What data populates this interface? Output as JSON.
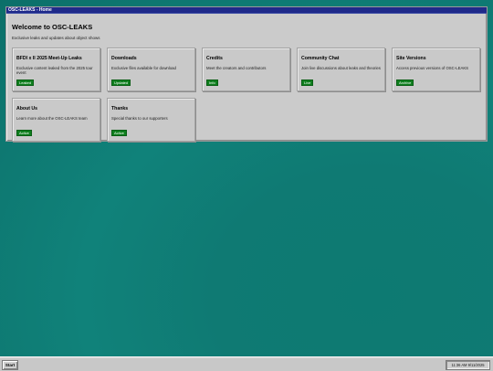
{
  "window": {
    "title": "OSC-LEAKS - Home",
    "heading": "Welcome to OSC-LEAKS",
    "subtitle": "Exclusive leaks and updates about object shows"
  },
  "cards": [
    {
      "title": "BFDI x II 2025 Meet-Up Leaks",
      "description": "Exclusive content leaked from the 2025 tour event",
      "badge": "Leaked"
    },
    {
      "title": "Downloads",
      "description": "Exclusive files available for download",
      "badge": "Updated"
    },
    {
      "title": "Credits",
      "description": "Meet the creators and contributors",
      "badge": "Info"
    },
    {
      "title": "Community Chat",
      "description": "Join live discussions about leaks and theories",
      "badge": "Live"
    },
    {
      "title": "Site Versions",
      "description": "Access previous versions of OSC-LEAKS",
      "badge": "Archive"
    },
    {
      "title": "About Us",
      "description": "Learn more about the OSC-LEAKS team",
      "badge": "Active"
    },
    {
      "title": "Thanks",
      "description": "Special thanks to our supporters",
      "badge": "Active"
    }
  ],
  "taskbar": {
    "start_label": "Start",
    "clock": "11:36 AM 9/11/2025"
  },
  "colors": {
    "desktop": "#0f7a73",
    "titlebar": "#1f2a8a",
    "badge": "#0f7f1e"
  }
}
